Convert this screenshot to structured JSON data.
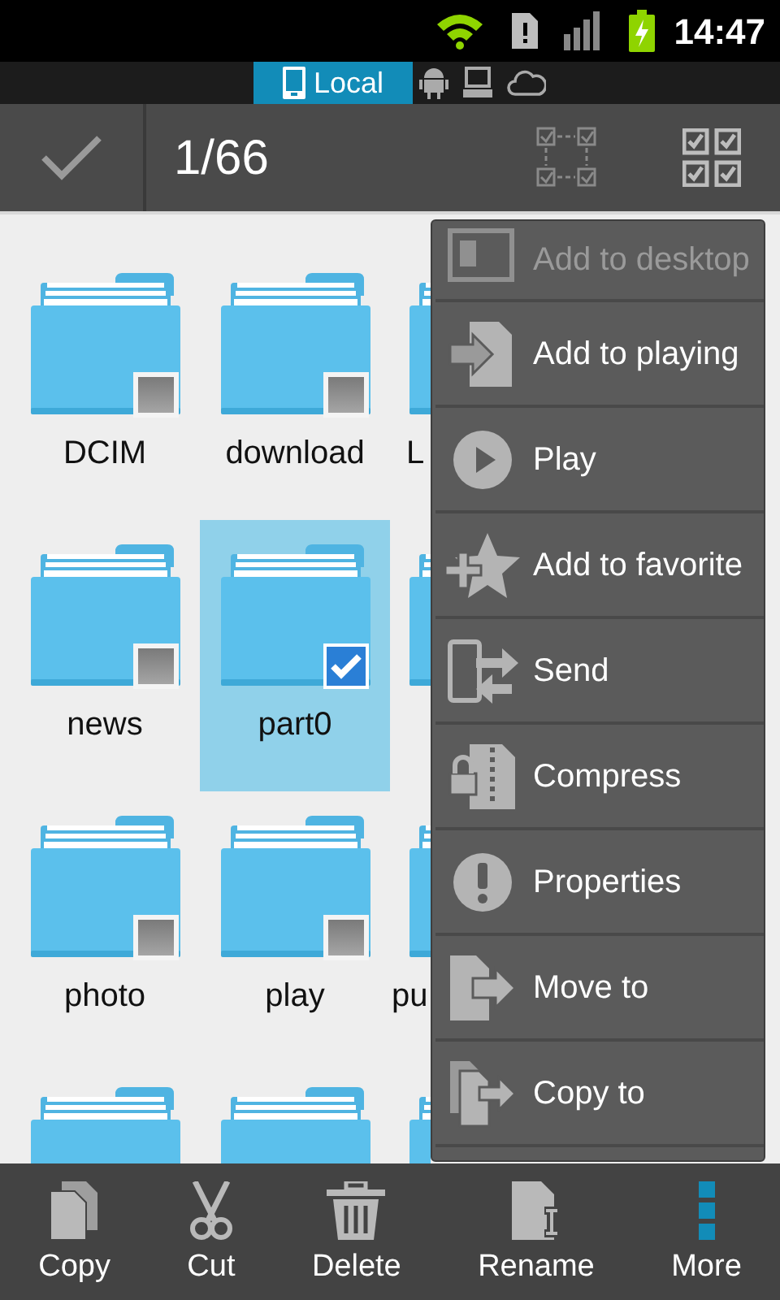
{
  "status_bar": {
    "time": "14:47"
  },
  "source_tabs": [
    {
      "kind": "local",
      "label": "Local",
      "selected": true
    },
    {
      "kind": "android",
      "selected": false
    },
    {
      "kind": "computer",
      "selected": false
    },
    {
      "kind": "cloud",
      "selected": false
    }
  ],
  "action_bar": {
    "title": "1/66"
  },
  "files": [
    {
      "kind": "folder",
      "name": "DCIM",
      "checked": false,
      "selected": false
    },
    {
      "kind": "folder",
      "name": "download",
      "checked": false,
      "selected": false
    },
    {
      "kind": "folder",
      "name": "L"
    },
    {
      "kind": "folder",
      "name": "news",
      "checked": false,
      "selected": false
    },
    {
      "kind": "folder",
      "name": "part0",
      "checked": true,
      "selected": true
    },
    {
      "kind": "folder"
    },
    {
      "kind": "folder",
      "name": "photo",
      "checked": false,
      "selected": false
    },
    {
      "kind": "folder",
      "name": "play",
      "checked": false,
      "selected": false
    },
    {
      "kind": "folder",
      "name": "pu"
    },
    {
      "kind": "folder"
    },
    {
      "kind": "folder"
    },
    {
      "kind": "folder"
    }
  ],
  "menu": [
    {
      "kind": "desktop",
      "label": "Add to desktop",
      "disabled": true
    },
    {
      "kind": "playing",
      "label": "Add to playing",
      "disabled": false
    },
    {
      "kind": "play",
      "label": "Play",
      "disabled": false
    },
    {
      "kind": "favorite",
      "label": "Add to favorite",
      "disabled": false
    },
    {
      "kind": "send",
      "label": "Send",
      "disabled": false
    },
    {
      "kind": "compress",
      "label": "Compress",
      "disabled": false
    },
    {
      "kind": "properties",
      "label": "Properties",
      "disabled": false
    },
    {
      "kind": "move",
      "label": "Move to",
      "disabled": false
    },
    {
      "kind": "copyto",
      "label": "Copy to",
      "disabled": false
    }
  ],
  "bottom_bar": [
    {
      "kind": "copy",
      "label": "Copy"
    },
    {
      "kind": "cut",
      "label": "Cut"
    },
    {
      "kind": "delete",
      "label": "Delete"
    },
    {
      "kind": "rename",
      "label": "Rename"
    },
    {
      "kind": "more",
      "label": "More"
    }
  ]
}
